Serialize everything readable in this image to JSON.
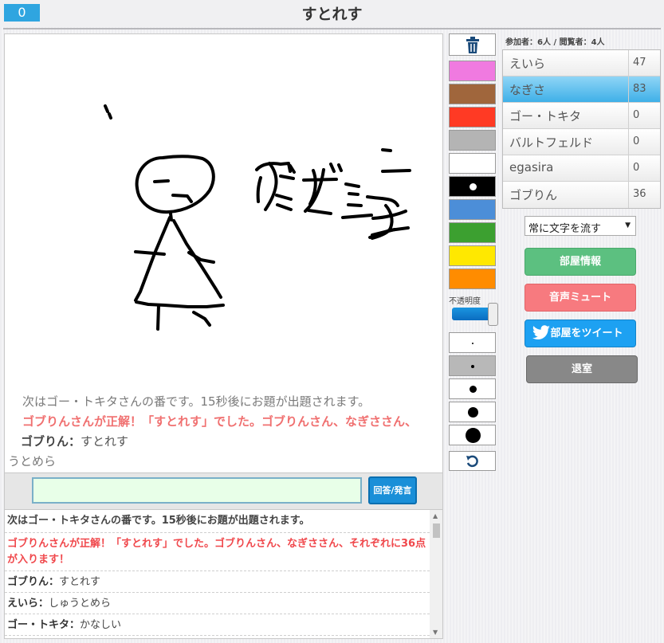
{
  "header": {
    "score": "0",
    "title": "すとれす"
  },
  "canvas_overlay": {
    "line1": "次はゴー・トキタさんの番です。15秒後にお題が出題されます。",
    "line2": "ゴブりんさんが正解！「すとれす」でした。ゴブりんさん、なぎささん、",
    "line3_name": "ゴブりん：",
    "line3_text": "すとれす",
    "line4": "うとめら"
  },
  "input": {
    "value": "",
    "button_label": "回答/発言"
  },
  "log": [
    {
      "type": "system",
      "text": "次はゴー・トキタさんの番です。15秒後にお題が出題されます。"
    },
    {
      "type": "correct",
      "text": "ゴブりんさんが正解！「すとれす」でした。ゴブりんさん、なぎささん、それぞれに36点が入ります！"
    },
    {
      "type": "chat",
      "name": "ゴブりん：",
      "text": "すとれす"
    },
    {
      "type": "chat",
      "name": "えいら：",
      "text": "しゅうとめら"
    },
    {
      "type": "chat",
      "name": "ゴー・トキタ：",
      "text": "かなしい"
    }
  ],
  "tools": {
    "colors": [
      "#f07ae0",
      "#a0663c",
      "#ff3a24",
      "#b4b4b4",
      "#ffffff",
      "#000000",
      "#4c8ed8",
      "#3ca030",
      "#ffe800",
      "#ff8c00"
    ],
    "opacity_label": "不透明度",
    "opacity": 1
  },
  "room": {
    "participants": "参加者：6人 / 閲覧者：4人",
    "players": [
      {
        "name": "えいら",
        "score": "47",
        "active": false
      },
      {
        "name": "なぎさ",
        "score": "83",
        "active": true
      },
      {
        "name": "ゴー・トキタ",
        "score": "0",
        "active": false
      },
      {
        "name": "バルトフェルド",
        "score": "0",
        "active": false
      },
      {
        "name": "egasira",
        "score": "0",
        "active": false
      },
      {
        "name": "ゴブりん",
        "score": "36",
        "active": false
      }
    ],
    "select_value": "常に文字を流す",
    "buttons": {
      "info": "部屋情報",
      "mute": "音声ミュート",
      "tweet": "部屋をツイート",
      "exit": "退室"
    }
  }
}
